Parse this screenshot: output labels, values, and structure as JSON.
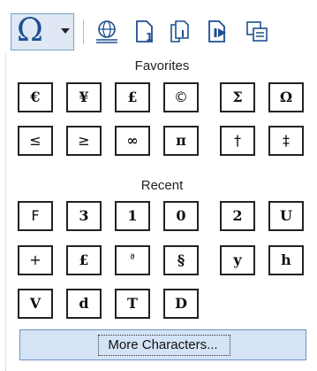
{
  "toolbar": {
    "special_char_glyph": "Ω",
    "icons": [
      "hyperlink-globe-icon",
      "insert-page-number-icon",
      "insert-page-count-icon",
      "insert-slide-icon",
      "insert-field-icon"
    ]
  },
  "favorites": {
    "title": "Favorites",
    "chars": [
      "€",
      "¥",
      "£",
      "©",
      "Σ",
      "Ω",
      "≤",
      "≥",
      "∞",
      "π",
      "†",
      "‡"
    ]
  },
  "recent": {
    "title": "Recent",
    "chars": [
      "F",
      "3",
      "1",
      "0",
      "2",
      "U",
      "+",
      "£",
      "ª",
      "§",
      "y",
      "h",
      "V",
      "d",
      "T",
      "D"
    ]
  },
  "more_button": {
    "label": "More Characters..."
  },
  "colors": {
    "accent": "#1d4f91",
    "button_bg": "#d4e3f6",
    "button_border": "#6f93c2"
  }
}
